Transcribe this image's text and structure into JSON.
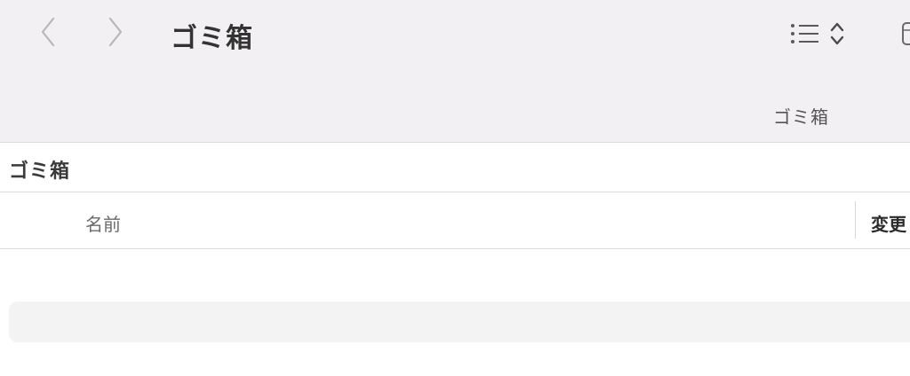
{
  "toolbar": {
    "title": "ゴミ箱",
    "back_icon": "chevron-left-icon",
    "forward_icon": "chevron-right-icon",
    "view_icon": "list-view-icon",
    "sort_icon": "up-down-chevron-icon",
    "group_icon": "group-icon"
  },
  "path_bar": {
    "label": "ゴミ箱"
  },
  "section": {
    "title": "ゴミ箱"
  },
  "columns": {
    "name": "名前",
    "modified": "変更"
  },
  "colors": {
    "toolbar_bg": "#f2f0f2",
    "row_placeholder": "#f3f3f3",
    "divider": "#dcdadc"
  }
}
